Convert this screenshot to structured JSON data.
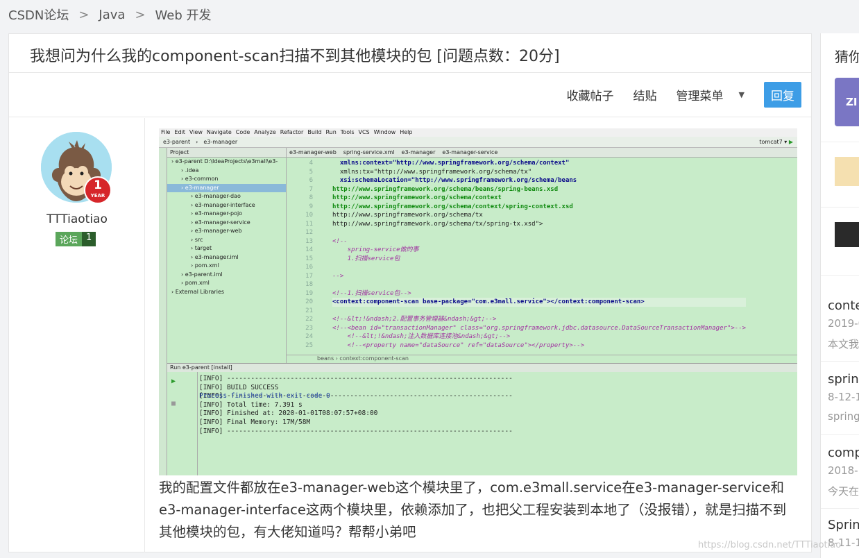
{
  "breadcrumb": {
    "items": [
      "CSDN论坛",
      "Java",
      "Web 开发"
    ],
    "separator": ">"
  },
  "post": {
    "title": "我想问为什么我的component-scan扫描不到其他模块的包 [问题点数：20分]",
    "actions": {
      "favorite": "收藏帖子",
      "close": "结贴",
      "manage": "管理菜单",
      "reply": "回复"
    },
    "author": {
      "name": "TTTiaotiao",
      "year_badge": "1",
      "year_label": "YEAR",
      "level_label": "论坛",
      "level": "1"
    },
    "body": "我的配置文件都放在e3-manager-web这个模块里了，com.e3mall.service在e3-manager-service和e3-manager-interface这两个模块里，依赖添加了，也把父工程安装到本地了（没报错），就是扫描不到其他模块的包，有大佬知道吗？帮帮小弟吧"
  },
  "ide": {
    "menu": [
      "File",
      "Edit",
      "View",
      "Navigate",
      "Code",
      "Analyze",
      "Refactor",
      "Build",
      "Run",
      "Tools",
      "VCS",
      "Window",
      "Help"
    ],
    "nav": [
      "e3-parent",
      "e3-manager"
    ],
    "run_config": "tomcat7",
    "project_header": "Project",
    "tree": [
      {
        "label": "e3-parent  D:\\IdeaProjects\\e3mall\\e3-",
        "indent": 0
      },
      {
        "label": ".idea",
        "indent": 1
      },
      {
        "label": "e3-common",
        "indent": 1
      },
      {
        "label": "e3-manager",
        "indent": 1,
        "selected": true
      },
      {
        "label": "e3-manager-dao",
        "indent": 2
      },
      {
        "label": "e3-manager-interface",
        "indent": 2
      },
      {
        "label": "e3-manager-pojo",
        "indent": 2
      },
      {
        "label": "e3-manager-service",
        "indent": 2
      },
      {
        "label": "e3-manager-web",
        "indent": 2
      },
      {
        "label": "src",
        "indent": 2
      },
      {
        "label": "target",
        "indent": 2
      },
      {
        "label": "e3-manager.iml",
        "indent": 2
      },
      {
        "label": "pom.xml",
        "indent": 2
      },
      {
        "label": "e3-parent.iml",
        "indent": 1
      },
      {
        "label": "pom.xml",
        "indent": 1
      },
      {
        "label": "External Libraries",
        "indent": 0
      }
    ],
    "tabs": [
      "e3-manager-web",
      "spring-service.xml",
      "e3-manager",
      "e3-manager-service"
    ],
    "line_numbers": [
      "4",
      "5",
      "6",
      "7",
      "8",
      "9",
      "10",
      "11",
      "12",
      "13",
      "14",
      "15",
      "16",
      "17",
      "18",
      "19",
      "20",
      "21",
      "22",
      "23",
      "24",
      "25"
    ],
    "code_lines": [
      {
        "text": "  xmlns:context=\"http://www.springframework.org/schema/context\"",
        "cls": "tagc"
      },
      {
        "text": "  xmlns:tx=\"http://www.springframework.org/schema/tx\"",
        "cls": ""
      },
      {
        "text": "  xsi:schemaLocation=\"http://www.springframework.org/schema/beans",
        "cls": "tagc"
      },
      {
        "text": "http://www.springframework.org/schema/beans/spring-beans.xsd",
        "cls": "str"
      },
      {
        "text": "http://www.springframework.org/schema/context",
        "cls": "str"
      },
      {
        "text": "http://www.springframework.org/schema/context/spring-context.xsd",
        "cls": "str"
      },
      {
        "text": "http://www.springframework.org/schema/tx",
        "cls": ""
      },
      {
        "text": "http://www.springframework.org/schema/tx/spring-tx.xsd\">",
        "cls": ""
      },
      {
        "text": "",
        "cls": ""
      },
      {
        "text": "<!--",
        "cls": "cm"
      },
      {
        "text": "    spring-service做的事",
        "cls": "cm"
      },
      {
        "text": "    1.扫描service包",
        "cls": "cm"
      },
      {
        "text": "",
        "cls": ""
      },
      {
        "text": "-->",
        "cls": "cm"
      },
      {
        "text": "",
        "cls": ""
      },
      {
        "text": "<!--1.扫描service包-->",
        "cls": "cm"
      },
      {
        "text": "<context:component-scan base-package=\"com.e3mall.service\"></context:component-scan>",
        "cls": "tagc hl"
      },
      {
        "text": "",
        "cls": ""
      },
      {
        "text": "<!--&lt;!&ndash;2.配置事务管理器&ndash;&gt;-->",
        "cls": "cm"
      },
      {
        "text": "<!--<bean id=\"transactionManager\" class=\"org.springframework.jdbc.datasource.DataSourceTransactionManager\">-->",
        "cls": "cm"
      },
      {
        "text": "    <!--&lt;!&ndash;注入数据库连接池&ndash;&gt;-->",
        "cls": "cm"
      },
      {
        "text": "    <!--<property name=\"dataSource\" ref=\"dataSource\"></property>-->",
        "cls": "cm"
      }
    ],
    "editor_crumb": "beans  ›  context:component-scan",
    "run_header": "Run   e3-parent [install]",
    "run_output": [
      "[INFO] ------------------------------------------------------------------------",
      "[INFO] BUILD SUCCESS",
      "[INFO] ------------------------------------------------------------------------",
      "[INFO] Total time: 7.391 s",
      "[INFO] Finished at: 2020-01-01T08:07:57+08:00",
      "[INFO] Final Memory: 17M/58M",
      "[INFO] ------------------------------------------------------------------------"
    ],
    "process_line": "Process finished with exit code 0"
  },
  "sidebar": {
    "heading": "猜你",
    "zi_label": "ZI",
    "items": [
      {
        "title": "conte",
        "date": "2019-0",
        "excerpt": "本文我"
      },
      {
        "title": "spring",
        "date": "8-12-1",
        "excerpt": "spring"
      },
      {
        "title": "comp",
        "date": "2018-",
        "excerpt": "今天在"
      },
      {
        "title": "Spring",
        "date": "8-11-1",
        "excerpt": ""
      }
    ]
  },
  "watermark": "https://blog.csdn.net/TTTiaotiao"
}
